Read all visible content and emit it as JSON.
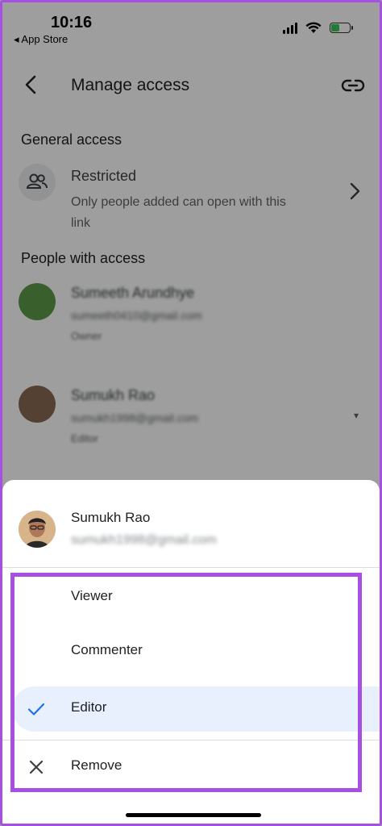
{
  "status_bar": {
    "time": "10:16",
    "back_app": "◂ App Store"
  },
  "header": {
    "title": "Manage access"
  },
  "general_access": {
    "heading": "General access",
    "title": "Restricted",
    "description": "Only people added can open with this link"
  },
  "people": {
    "heading": "People with access",
    "list": [
      {
        "name": "Sumeeth Arundhye",
        "email": "sumeeth0410@gmail.com",
        "role": "Owner"
      },
      {
        "name": "Sumukh Rao",
        "email": "sumukh1998@gmail.com",
        "role": "Editor"
      }
    ]
  },
  "sheet": {
    "name": "Sumukh Rao",
    "email": "sumukh1998@gmail.com",
    "options": [
      {
        "label": "Viewer",
        "selected": false
      },
      {
        "label": "Commenter",
        "selected": false
      },
      {
        "label": "Editor",
        "selected": true
      },
      {
        "label": "Remove",
        "selected": false
      }
    ]
  },
  "colors": {
    "accent": "#a64fe0",
    "selected_bg": "#e8f0fe",
    "check": "#1a73e8",
    "owner_avatar": "#5c9b47"
  }
}
